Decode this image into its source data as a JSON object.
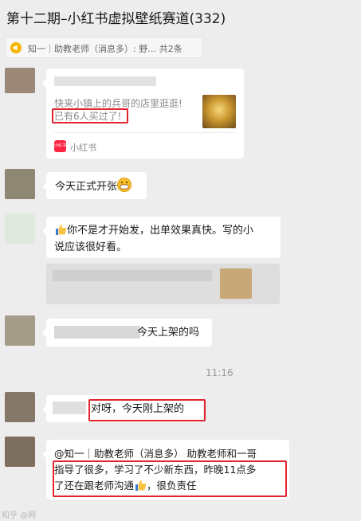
{
  "chat": {
    "title": "第十二期–小红书虚拟壁纸赛道(332)"
  },
  "pinned": {
    "text": "知一｜助教老师（消息多）: 野…",
    "count": "共2条",
    "icon": "megaphone-icon"
  },
  "messages": {
    "card": {
      "line1": "快来小镇上的兵哥的店里逛逛!",
      "line2": "已有6人买过了!",
      "app_name": "小红书",
      "app_badge": "小红书"
    },
    "m2": {
      "text": "今天正式开张"
    },
    "m3": {
      "text_line1": "你不是才开始发，出单效果真快。写的小",
      "text_line2": "说应该很好看。"
    },
    "m4": {
      "text": "今天上架的吗"
    },
    "time": "11:16",
    "m5": {
      "text": "对呀，今天刚上架的"
    },
    "m6": {
      "line1": "@知一｜助教老师（消息多） 助教老师和一哥",
      "line2": "指导了很多，学习了不少新东西，昨晚11点多",
      "line3a": "了还在跟老师沟通",
      "line3b": "，很负责任"
    }
  },
  "watermark": "知乎 @网",
  "colors": {
    "background": "#ededed",
    "bubble": "#ffffff",
    "highlight": "#e1242e",
    "brand_red": "#ff2442"
  }
}
